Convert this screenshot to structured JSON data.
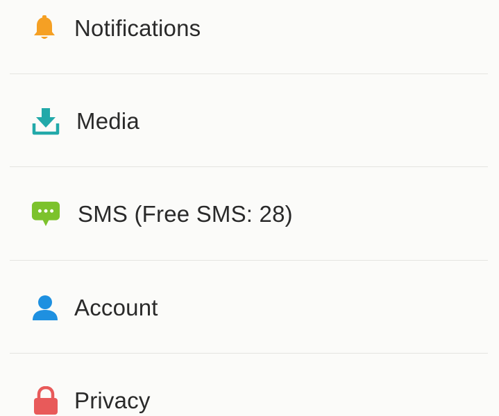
{
  "settings": {
    "items": [
      {
        "id": "notifications",
        "label": "Notifications",
        "icon": "bell-icon",
        "icon_color": "#f5a024"
      },
      {
        "id": "media",
        "label": "Media",
        "icon": "download-icon",
        "icon_color": "#22a9a9"
      },
      {
        "id": "sms",
        "label": "SMS (Free SMS: 28)",
        "icon": "chat-bubble-icon",
        "icon_color": "#7cc22c"
      },
      {
        "id": "account",
        "label": "Account",
        "icon": "person-icon",
        "icon_color": "#1e90e0"
      },
      {
        "id": "privacy",
        "label": "Privacy",
        "icon": "lock-icon",
        "icon_color": "#e85a5a"
      }
    ]
  }
}
